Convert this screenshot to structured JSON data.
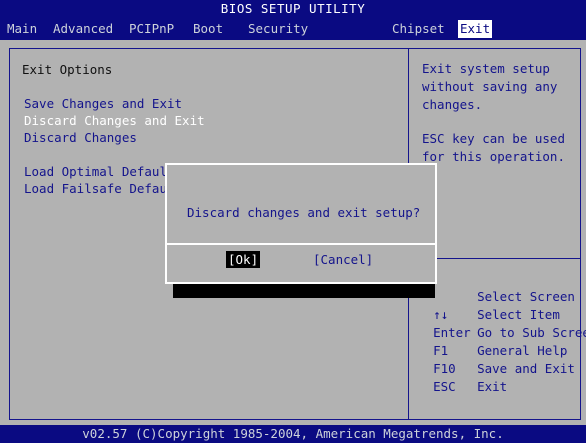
{
  "title": "BIOS SETUP UTILITY",
  "menu": {
    "items": [
      {
        "label": "Main"
      },
      {
        "label": "Advanced"
      },
      {
        "label": "PCIPnP"
      },
      {
        "label": "Boot"
      },
      {
        "label": "Security"
      },
      {
        "label": "Chipset"
      },
      {
        "label": "Exit"
      }
    ],
    "active": "Exit"
  },
  "main": {
    "section_title": "Exit Options",
    "options": [
      {
        "label": "Save Changes and Exit"
      },
      {
        "label": "Discard Changes and Exit"
      },
      {
        "label": "Discard Changes"
      },
      {
        "label": "Load Optimal Defaul"
      },
      {
        "label": "Load Failsafe Defau"
      }
    ],
    "selected_index": 1
  },
  "help": {
    "line1": "Exit system setup",
    "line2": "without saving any",
    "line3": "changes.",
    "line4": "ESC key can be used",
    "line5": "for this operation."
  },
  "keys": [
    {
      "key": "",
      "action": "Select Screen"
    },
    {
      "key": "↑↓",
      "action": "Select Item"
    },
    {
      "key": "Enter",
      "action": "Go to Sub Screen"
    },
    {
      "key": "F1",
      "action": "General Help"
    },
    {
      "key": "F10",
      "action": "Save and Exit"
    },
    {
      "key": "ESC",
      "action": "Exit"
    }
  ],
  "dialog": {
    "message": "Discard changes and exit setup?",
    "ok_label": "[Ok]",
    "cancel_label": "[Cancel]"
  },
  "footer": "v02.57 (C)Copyright 1985-2004, American Megatrends, Inc.",
  "colors": {
    "bar_bg": "#0a0a82",
    "panel_bg": "#b2b2b2",
    "text_blue": "#14148c",
    "highlight": "#ffffff"
  }
}
